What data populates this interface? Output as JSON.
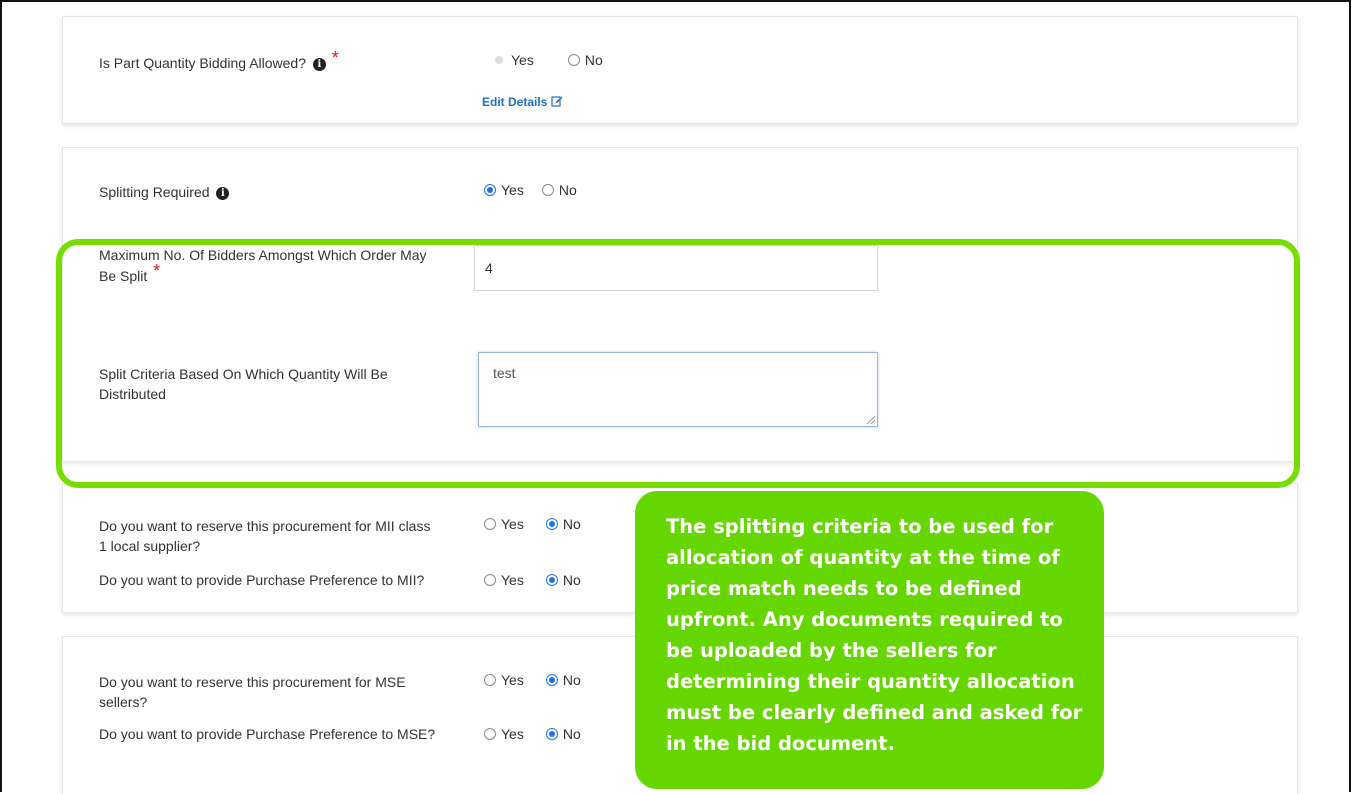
{
  "part_quantity": {
    "question": "Is Part Quantity Bidding Allowed?",
    "yes_label": "Yes",
    "no_label": "No",
    "edit_label": "Edit Details",
    "selected": "yes-disabled"
  },
  "splitting": {
    "question": "Splitting Required",
    "yes_label": "Yes",
    "no_label": "No",
    "selected": "yes",
    "max_bidders_label_line1": "Maximum No. Of Bidders Amongst Which Order May",
    "max_bidders_label_line2": "Be Split",
    "max_bidders_value": "4",
    "criteria_label_line1": "Split Criteria Based On Which Quantity Will Be",
    "criteria_label_line2": "Distributed",
    "criteria_value": "test"
  },
  "mii": {
    "reserve_question_line1": "Do you want to reserve this procurement for MII class",
    "reserve_question_line2": "1 local supplier?",
    "preference_question": "Do you want to provide Purchase Preference to MII?",
    "yes_label": "Yes",
    "no_label": "No",
    "reserve_selected": "no",
    "preference_selected": "no"
  },
  "mse": {
    "reserve_question_line1": "Do you want to reserve this procurement for MSE",
    "reserve_question_line2": "sellers?",
    "preference_question": "Do you want to provide Purchase Preference to MSE?",
    "yes_label": "Yes",
    "no_label": "No",
    "reserve_selected": "no",
    "preference_selected": "no"
  },
  "callout": {
    "text": "The splitting criteria to be used for allocation of quantity at the time of price match needs to be defined upfront. Any documents required to be uploaded by the sellers for determining their quantity allocation must be clearly defined and asked for in the bid document."
  },
  "colors": {
    "highlight": "#77dd00",
    "callout_bg": "#66d600",
    "radio_selected": "#1a73e8",
    "required": "#e01b1b",
    "link": "#1f6fc5"
  }
}
